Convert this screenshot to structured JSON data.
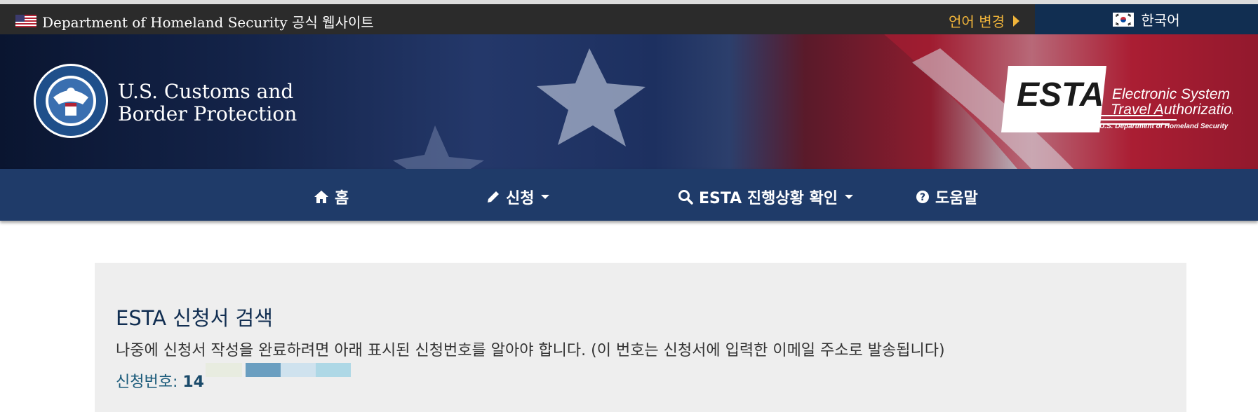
{
  "topbar": {
    "official_text": "Department of Homeland Security 공식 웹사이트",
    "language_change": "언어 변경",
    "current_language": "한국어"
  },
  "header": {
    "agency_line1": "U.S. Customs and",
    "agency_line2": "Border Protection",
    "esta_acronym": "ESTA",
    "esta_line1": "Electronic System for",
    "esta_line2": "Travel Authorization",
    "esta_dept": "U.S. Department of Homeland Security"
  },
  "nav": {
    "items": [
      {
        "label": "홈",
        "icon": "home-icon"
      },
      {
        "label": "신청",
        "icon": "pencil-icon"
      },
      {
        "label": "ESTA 진행상황 확인",
        "icon": "search-icon"
      },
      {
        "label": "도움말",
        "icon": "question-icon"
      }
    ]
  },
  "panel": {
    "title": "ESTA 신청서 검색",
    "description": "나중에 신청서 작성을 완료하려면 아래 표시된 신청번호를 알아야 합니다. (이 번호는 신청서에 입력한 이메일 주소로 발송됩니다)",
    "application_label": "신청번호:",
    "application_number_visible": "14"
  },
  "colors": {
    "topbar_bg": "#2b2b2b",
    "language_accent": "#f0b43a",
    "language_bg": "#112e51",
    "nav_bg": "#1f3b69",
    "panel_bg": "#eeeeee",
    "title_color": "#112e51"
  }
}
